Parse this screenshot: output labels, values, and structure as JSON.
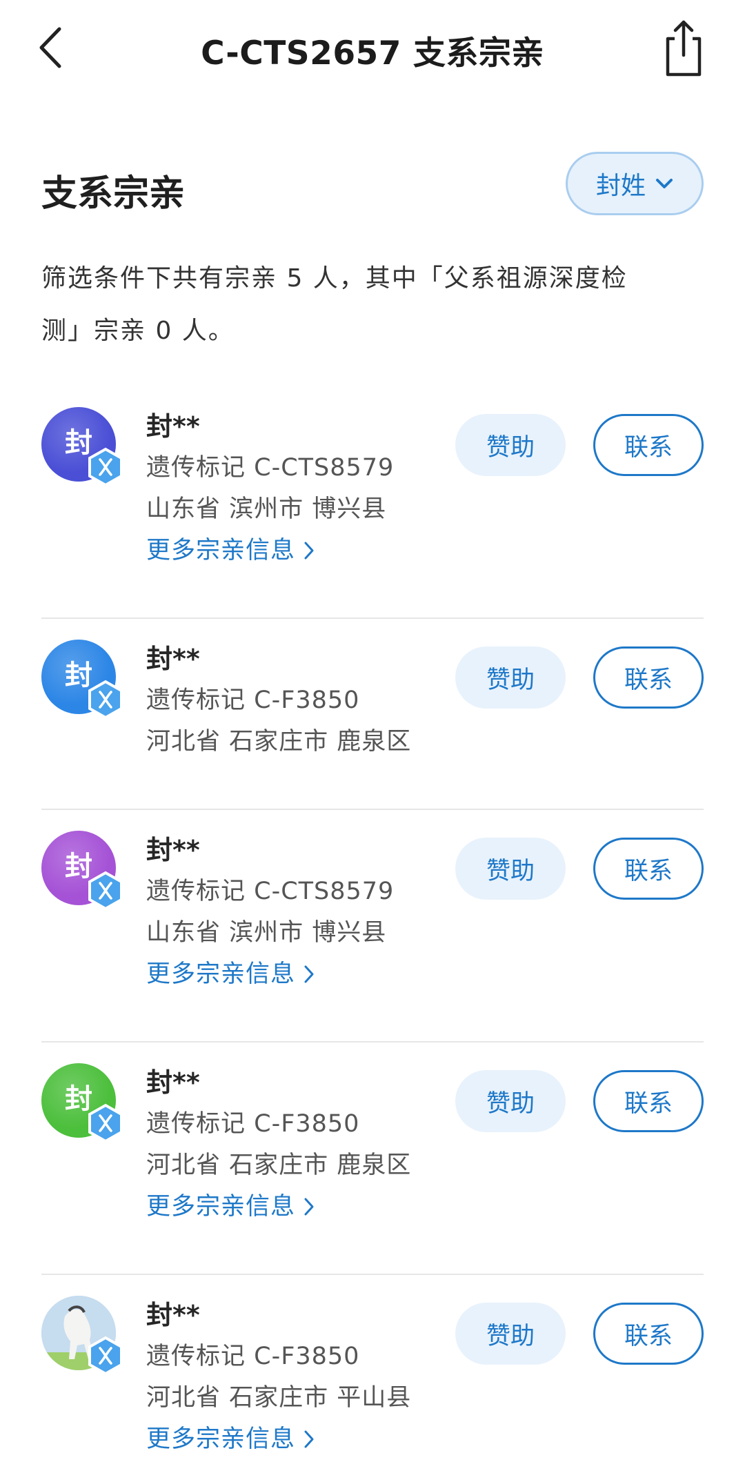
{
  "header": {
    "title": "C-CTS2657 支系宗亲"
  },
  "section": {
    "title": "支系宗亲",
    "filter_label": "封姓"
  },
  "summary": {
    "line1": "筛选条件下共有宗亲 5 人，其中「父系祖源深度检",
    "line2": "测」宗亲 0 人。"
  },
  "relatives": [
    {
      "avatar_char": "封",
      "avatar_color": "#4a4fd6",
      "name": "封**",
      "marker": "遗传标记 C-CTS8579",
      "location": "山东省 滨州市 博兴县",
      "more": "更多宗亲信息",
      "sponsor": "赞助",
      "contact": "联系"
    },
    {
      "avatar_char": "封",
      "avatar_color": "#2c86e6",
      "name": "封**",
      "marker": "遗传标记 C-F3850",
      "location": "河北省 石家庄市 鹿泉区",
      "more": "",
      "sponsor": "赞助",
      "contact": "联系"
    },
    {
      "avatar_char": "封",
      "avatar_color": "#a552d6",
      "name": "封**",
      "marker": "遗传标记 C-CTS8579",
      "location": "山东省 滨州市 博兴县",
      "more": "更多宗亲信息",
      "sponsor": "赞助",
      "contact": "联系"
    },
    {
      "avatar_char": "封",
      "avatar_color": "#4cbf3c",
      "name": "封**",
      "marker": "遗传标记 C-F3850",
      "location": "河北省 石家庄市 鹿泉区",
      "more": "更多宗亲信息",
      "sponsor": "赞助",
      "contact": "联系"
    },
    {
      "avatar_char": "",
      "avatar_color": "#b9d3ea",
      "avatar_icon": "horse-photo",
      "name": "封**",
      "marker": "遗传标记 C-F3850",
      "location": "河北省 石家庄市 平山县",
      "more": "更多宗亲信息",
      "sponsor": "赞助",
      "contact": "联系"
    }
  ],
  "colors": {
    "accent": "#1e78c8",
    "badge": "#4aa3ec"
  }
}
